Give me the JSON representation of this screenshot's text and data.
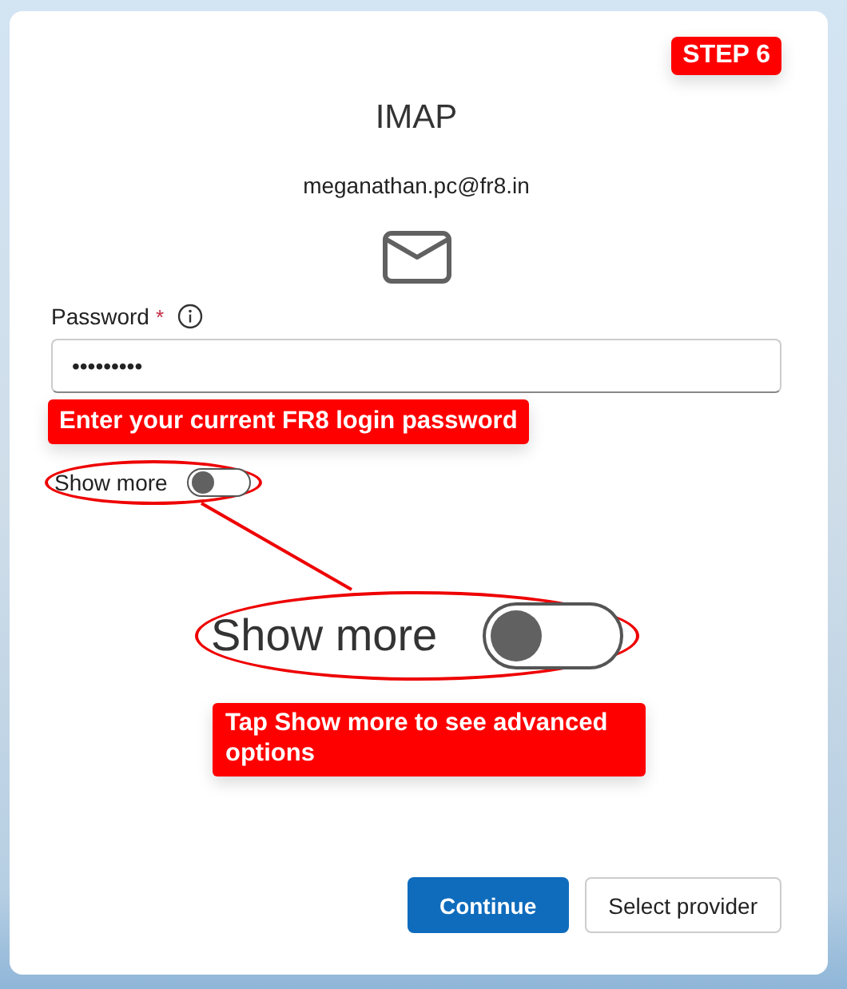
{
  "step_badge": "STEP 6",
  "title": "IMAP",
  "email": "meganathan.pc@fr8.in",
  "password": {
    "label": "Password",
    "required_mark": "*",
    "value": "•••••••••"
  },
  "password_callout": "Enter your current FR8 login password",
  "show_more": {
    "label": "Show more",
    "on": false
  },
  "zoom": {
    "label": "Show more",
    "on": false
  },
  "zoom_callout": "Tap Show more to see advanced options",
  "buttons": [
    {
      "label": "Continue",
      "kind": "primary"
    },
    {
      "label": "Select provider",
      "kind": "secondary"
    }
  ]
}
